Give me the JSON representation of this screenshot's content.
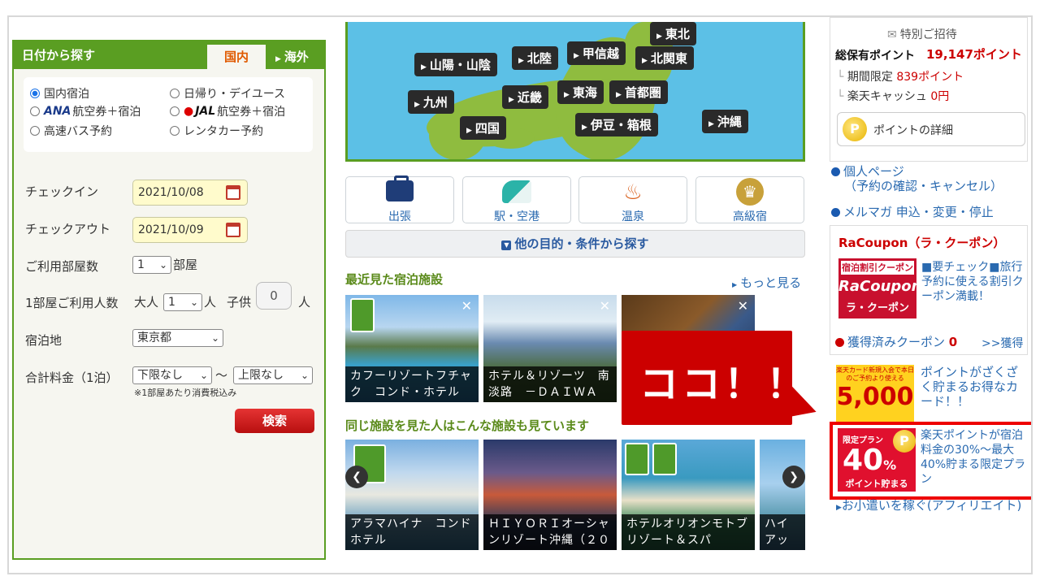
{
  "search": {
    "title": "日付から探す",
    "tab_domestic": "国内",
    "tab_overseas": "海外",
    "types": [
      "国内宿泊",
      "日帰り・デイユース",
      "ANA",
      "航空券＋宿泊",
      "JAL",
      "航空券＋宿泊",
      "高速バス予約",
      "レンタカー予約"
    ],
    "checkin_label": "チェックイン",
    "checkin_value": "2021/10/08",
    "checkout_label": "チェックアウト",
    "checkout_value": "2021/10/09",
    "rooms_label": "ご利用部屋数",
    "rooms_value": "1",
    "rooms_unit": "部屋",
    "guests_label": "1部屋ご利用人数",
    "adult_label": "大人",
    "adult_value": "1",
    "adult_unit": "人",
    "child_label": "子供",
    "child_value": "0",
    "child_unit": "人",
    "dest_label": "宿泊地",
    "dest_value": "東京都",
    "price_label": "合計料金（1泊）",
    "price_min": "下限なし",
    "price_sep": "～",
    "price_max": "上限なし",
    "price_note": "※1部屋あたり消費税込み",
    "search_button": "検索"
  },
  "map": {
    "regions": [
      "東北",
      "山陽・山陰",
      "北陸",
      "甲信越",
      "北関東",
      "九州",
      "近畿",
      "東海",
      "首都圏",
      "沖縄",
      "四国",
      "伊豆・箱根"
    ]
  },
  "purposes": [
    "出張",
    "駅・空港",
    "温泉",
    "高級宿"
  ],
  "more_conditions": "他の目的・条件から探す",
  "recent": {
    "title": "最近見た宿泊施設",
    "see_more": "もっと見る",
    "cards": [
      "カフーリゾートフチャク　コンド・ホテル",
      "ホテル＆リゾーツ　南淡路　－ＤＡＩＷＡ",
      ""
    ]
  },
  "also_viewed": {
    "title": "同じ施設を見た人はこんな施設も見ています",
    "cards": [
      "アラマハイナ　コンドホテル",
      "ＨＩＹＯＲＩオーシャンリゾート沖縄（２０",
      "ホテルオリオンモトブリゾート＆スパ",
      "ハイアットリージェンシー"
    ]
  },
  "points": {
    "invite": "特別ご招待",
    "total_label": "総保有ポイント",
    "total_value": "19,147ポイント",
    "limited_label": "期間限定",
    "limited_value": "839ポイント",
    "cash_label": "楽天キャッシュ",
    "cash_value": "0円",
    "detail_button": "ポイントの詳細"
  },
  "links": {
    "mypage_line1": "個人ページ",
    "mypage_line2": "（予約の確認・キャンセル）",
    "mailmag": "メルマガ 申込・変更・停止",
    "affiliate": "お小遣いを稼ぐ(アフィリエイト)"
  },
  "racoupon": {
    "title": "RaCoupon（ラ・クーポン）",
    "logo_top": "宿泊割引クーポン",
    "logo_main": "RaCoupon",
    "logo_sub": "ラ・クーポン",
    "desc": "■要チェック■旅行予約に使える割引クーポン満載！",
    "acquired_label": "獲得済みクーポン",
    "acquired_count": "0",
    "acquired_link": ">>獲得"
  },
  "promo1": {
    "small": "楽天カード新規入会で本日のご予約より使える",
    "num": "5,000",
    "desc": "ポイントがざくざく貯まるお得なカード！！"
  },
  "promo2": {
    "tag": "限定プラン",
    "num": "40",
    "pct": "%",
    "foot": "ポイント貯まる",
    "desc": "楽天ポイントが宿泊料金の30%～最大40%貯まる限定プラン"
  },
  "callout": "ココ！！",
  "icons": {
    "coin": "P"
  }
}
